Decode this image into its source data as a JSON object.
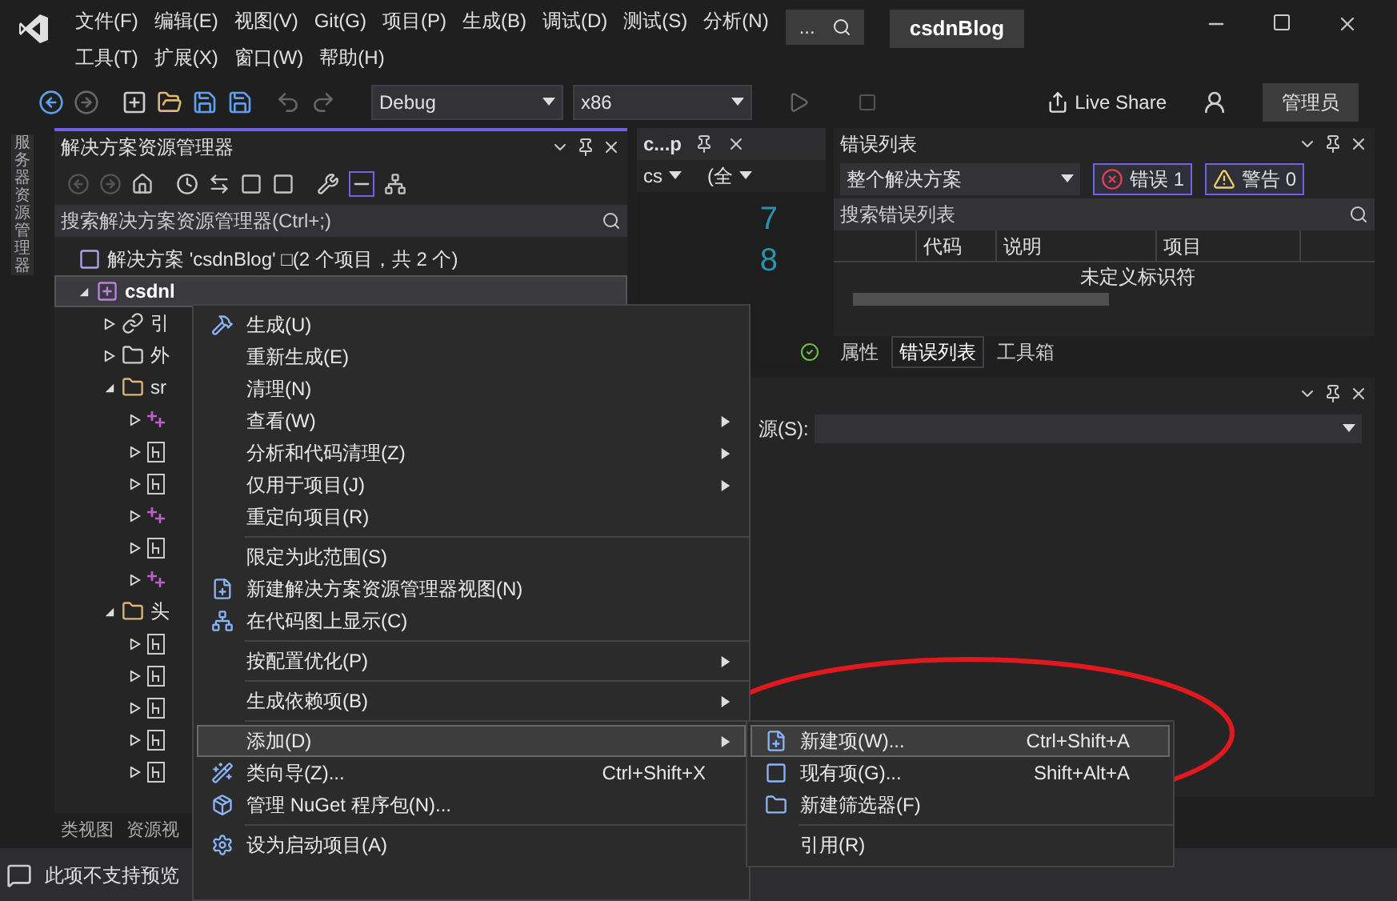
{
  "menu_bar": [
    {
      "label": "文件(F)"
    },
    {
      "label": "编辑(E)"
    },
    {
      "label": "视图(V)"
    },
    {
      "label": "Git(G)"
    },
    {
      "label": "项目(P)"
    },
    {
      "label": "生成(B)"
    },
    {
      "label": "调试(D)"
    },
    {
      "label": "测试(S)"
    },
    {
      "label": "分析(N)"
    }
  ],
  "menu_bar_row2": [
    {
      "label": "工具(T)"
    },
    {
      "label": "扩展(X)"
    },
    {
      "label": "窗口(W)"
    },
    {
      "label": "帮助(H)"
    }
  ],
  "search": {
    "label": "..."
  },
  "project_badge": "csdnBlog",
  "toolbar": {
    "configuration": "Debug",
    "platform": "x86",
    "live_share": "Live Share",
    "admin": "管理员"
  },
  "left_strip": {
    "label": "服务器资源管理器"
  },
  "solution_explorer": {
    "title": "解决方案资源管理器",
    "search_placeholder": "搜索解决方案资源管理器(Ctrl+;)",
    "tree": [
      {
        "label": "解决方案 'csdnBlog' □(2 个项目，共 2 个)",
        "kind": "solution",
        "selected": false,
        "children": [
          {
            "label": "csdnl",
            "kind": "project",
            "expanded": true,
            "selected": true,
            "children": [
              {
                "label": "引",
                "kind": "references",
                "expanded": false,
                "selected": false
              },
              {
                "label": "外",
                "kind": "external",
                "expanded": false,
                "selected": false
              },
              {
                "label": "sr",
                "kind": "filter",
                "expanded": true,
                "selected": false,
                "children": [
                  {
                    "kind": "cpp",
                    "expanded": false,
                    "selected": false
                  },
                  {
                    "kind": "header",
                    "expanded": false,
                    "selected": false
                  },
                  {
                    "kind": "header",
                    "expanded": false,
                    "selected": false
                  },
                  {
                    "kind": "cpp",
                    "expanded": false,
                    "selected": false
                  },
                  {
                    "kind": "header",
                    "expanded": false,
                    "selected": false
                  },
                  {
                    "kind": "cpp",
                    "expanded": false,
                    "selected": false
                  }
                ]
              },
              {
                "label": "头",
                "kind": "filter",
                "expanded": true,
                "selected": false,
                "children": [
                  {
                    "kind": "header",
                    "expanded": false,
                    "selected": false
                  },
                  {
                    "kind": "header",
                    "expanded": false,
                    "selected": false
                  },
                  {
                    "kind": "header",
                    "expanded": false,
                    "selected": false
                  },
                  {
                    "kind": "header",
                    "expanded": false,
                    "selected": false
                  },
                  {
                    "kind": "header",
                    "expanded": false,
                    "selected": false
                  }
                ]
              }
            ]
          }
        ]
      }
    ],
    "bottom_tabs": [
      {
        "label": "类视图",
        "selected": false
      },
      {
        "label": "资源视",
        "selected": false
      }
    ]
  },
  "code_panel": {
    "tab": "c...p",
    "scope": "cs",
    "member": "(全",
    "line_numbers": [
      "7",
      "8"
    ]
  },
  "error_list": {
    "title": "错误列表",
    "scope": "整个解决方案",
    "errors": {
      "label": "错误 1",
      "selected": true
    },
    "warnings": {
      "label": "警告 0",
      "selected": true
    },
    "search_placeholder": "搜索错误列表",
    "columns": [
      "代码",
      "说明",
      "项目"
    ],
    "rows": [
      {
        "description": "未定义标识符"
      }
    ]
  },
  "panel_tabs": [
    {
      "label": "属性",
      "selected": false
    },
    {
      "label": "错误列表",
      "selected": true
    },
    {
      "label": "工具箱",
      "selected": false
    }
  ],
  "output_panel": {
    "source_label": "源(S):"
  },
  "status_bar": {
    "text": "此项不支持预览"
  },
  "context_menu": [
    {
      "kind": "item",
      "label": "生成(U)",
      "submenu": false,
      "selected": false
    },
    {
      "kind": "item",
      "label": "重新生成(E)",
      "submenu": false,
      "selected": false
    },
    {
      "kind": "item",
      "label": "清理(N)",
      "submenu": false,
      "selected": false
    },
    {
      "kind": "item",
      "label": "查看(W)",
      "submenu": true,
      "selected": false
    },
    {
      "kind": "item",
      "label": "分析和代码清理(Z)",
      "submenu": true,
      "selected": false
    },
    {
      "kind": "item",
      "label": "仅用于项目(J)",
      "submenu": true,
      "selected": false
    },
    {
      "kind": "item",
      "label": "重定向项目(R)",
      "submenu": false,
      "selected": false
    },
    {
      "kind": "separator"
    },
    {
      "kind": "item",
      "label": "限定为此范围(S)",
      "submenu": false,
      "selected": false
    },
    {
      "kind": "item",
      "label": "新建解决方案资源管理器视图(N)",
      "submenu": false,
      "selected": false
    },
    {
      "kind": "item",
      "label": "在代码图上显示(C)",
      "submenu": false,
      "selected": false
    },
    {
      "kind": "separator"
    },
    {
      "kind": "item",
      "label": "按配置优化(P)",
      "submenu": true,
      "selected": false
    },
    {
      "kind": "separator"
    },
    {
      "kind": "item",
      "label": "生成依赖项(B)",
      "submenu": true,
      "selected": false
    },
    {
      "kind": "separator"
    },
    {
      "kind": "item",
      "label": "添加(D)",
      "submenu": true,
      "selected": true
    },
    {
      "kind": "item",
      "label": "类向导(Z)...",
      "shortcut": "Ctrl+Shift+X",
      "submenu": false,
      "selected": false
    },
    {
      "kind": "item",
      "label": "管理 NuGet 程序包(N)...",
      "submenu": false,
      "selected": false
    },
    {
      "kind": "separator"
    },
    {
      "kind": "item",
      "label": "设为启动项目(A)",
      "submenu": false,
      "selected": false
    }
  ],
  "add_submenu": [
    {
      "kind": "item",
      "label": "新建项(W)...",
      "shortcut": "Ctrl+Shift+A",
      "selected": true
    },
    {
      "kind": "item",
      "label": "现有项(G)...",
      "shortcut": "Shift+Alt+A",
      "selected": false
    },
    {
      "kind": "item",
      "label": "新建筛选器(F)",
      "selected": false
    },
    {
      "kind": "separator"
    },
    {
      "kind": "item",
      "label": "引用(R)",
      "selected": false
    }
  ],
  "annotation": {
    "kind": "ellipse",
    "color": "#e0191f"
  }
}
